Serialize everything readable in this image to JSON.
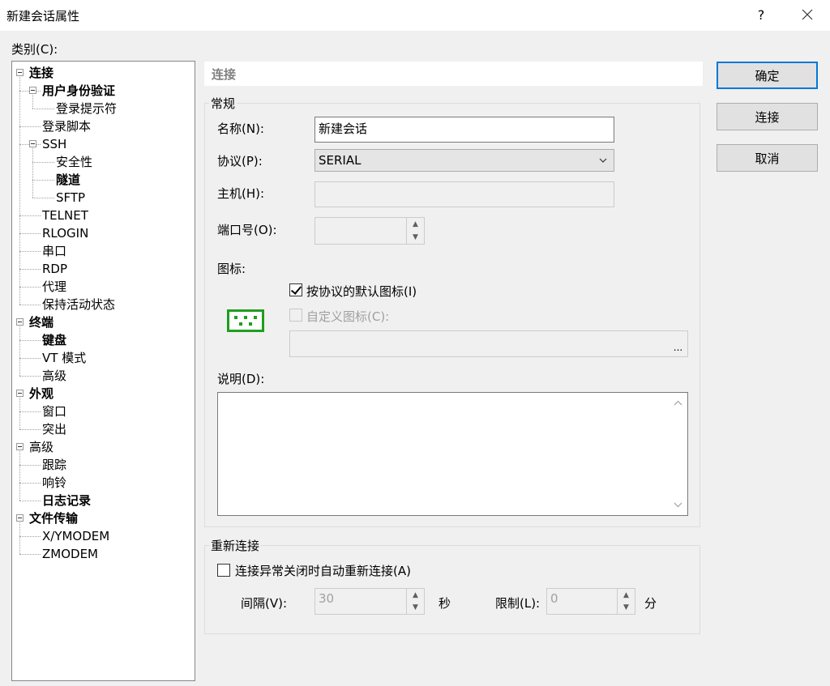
{
  "window": {
    "title": "新建会话属性",
    "help": "?",
    "close": "✕"
  },
  "category_label": "类别(C):",
  "tree": [
    {
      "label": "连接",
      "level": 0,
      "bold": true,
      "expander": true
    },
    {
      "label": "用户身份验证",
      "level": 1,
      "bold": true,
      "expander": true
    },
    {
      "label": "登录提示符",
      "level": 2,
      "bold": false
    },
    {
      "label": "登录脚本",
      "level": 1,
      "bold": false
    },
    {
      "label": "SSH",
      "level": 1,
      "bold": false,
      "expander": true
    },
    {
      "label": "安全性",
      "level": 2,
      "bold": false
    },
    {
      "label": "隧道",
      "level": 2,
      "bold": true
    },
    {
      "label": "SFTP",
      "level": 2,
      "bold": false
    },
    {
      "label": "TELNET",
      "level": 1,
      "bold": false
    },
    {
      "label": "RLOGIN",
      "level": 1,
      "bold": false
    },
    {
      "label": "串口",
      "level": 1,
      "bold": false
    },
    {
      "label": "RDP",
      "level": 1,
      "bold": false
    },
    {
      "label": "代理",
      "level": 1,
      "bold": false
    },
    {
      "label": "保持活动状态",
      "level": 1,
      "bold": false
    },
    {
      "label": "终端",
      "level": 0,
      "bold": true,
      "expander": true
    },
    {
      "label": "键盘",
      "level": 1,
      "bold": true
    },
    {
      "label": "VT 模式",
      "level": 1,
      "bold": false
    },
    {
      "label": "高级",
      "level": 1,
      "bold": false
    },
    {
      "label": "外观",
      "level": 0,
      "bold": true,
      "expander": true
    },
    {
      "label": "窗口",
      "level": 1,
      "bold": false
    },
    {
      "label": "突出",
      "level": 1,
      "bold": false
    },
    {
      "label": "高级",
      "level": 0,
      "bold": false,
      "expander": true
    },
    {
      "label": "跟踪",
      "level": 1,
      "bold": false
    },
    {
      "label": "响铃",
      "level": 1,
      "bold": false
    },
    {
      "label": "日志记录",
      "level": 1,
      "bold": true
    },
    {
      "label": "文件传输",
      "level": 0,
      "bold": true,
      "expander": true
    },
    {
      "label": "X/YMODEM",
      "level": 1,
      "bold": false
    },
    {
      "label": "ZMODEM",
      "level": 1,
      "bold": false
    }
  ],
  "panel": {
    "header": "连接",
    "general": {
      "title": "常规",
      "name_label": "名称(N):",
      "name_value": "新建会话",
      "protocol_label": "协议(P):",
      "protocol_value": "SERIAL",
      "host_label": "主机(H):",
      "host_value": "",
      "port_label": "端口号(O):",
      "port_value": "",
      "icon_label": "图标:",
      "default_icon_label": "按协议的默认图标(I)",
      "default_icon_checked": true,
      "custom_icon_label": "自定义图标(C):",
      "custom_icon_checked": false,
      "browse_label": "...",
      "desc_label": "说明(D):",
      "desc_value": ""
    },
    "reconnect": {
      "title": "重新连接",
      "auto_label": "连接异常关闭时自动重新连接(A)",
      "auto_checked": false,
      "interval_label": "间隔(V):",
      "interval_value": "30",
      "sec_label": "秒",
      "limit_label": "限制(L):",
      "limit_value": "0",
      "min_label": "分"
    }
  },
  "buttons": {
    "ok": "确定",
    "connect": "连接",
    "cancel": "取消"
  },
  "colors": {
    "accent": "#0078d7",
    "icon_green": "#1f9e1f"
  },
  "icons": {
    "protocol_icon": "serial-port-icon"
  }
}
